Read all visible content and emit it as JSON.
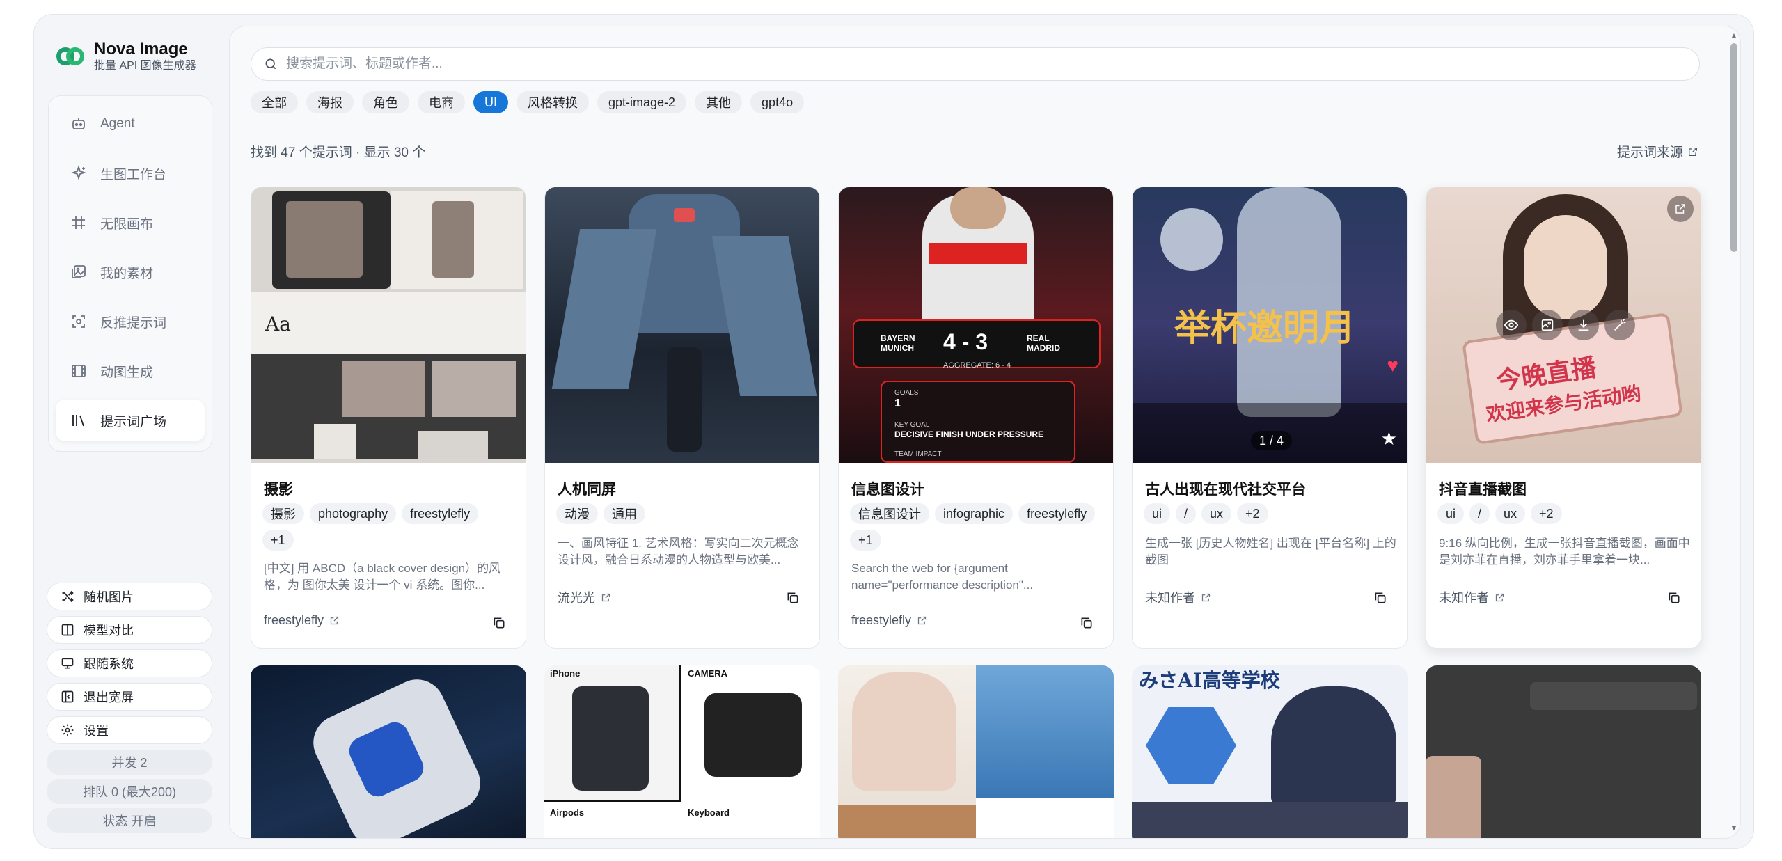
{
  "brand": {
    "name": "Nova Image",
    "subtitle": "批量 API 图像生成器"
  },
  "nav": [
    {
      "label": "Agent",
      "icon": "robot-icon"
    },
    {
      "label": "生图工作台",
      "icon": "sparkle-icon"
    },
    {
      "label": "无限画布",
      "icon": "hash-icon"
    },
    {
      "label": "我的素材",
      "icon": "images-icon"
    },
    {
      "label": "反推提示词",
      "icon": "scan-icon"
    },
    {
      "label": "动图生成",
      "icon": "film-icon"
    },
    {
      "label": "提示词广场",
      "icon": "library-icon",
      "active": true
    }
  ],
  "tools": [
    {
      "label": "随机图片",
      "icon": "shuffle-icon"
    },
    {
      "label": "模型对比",
      "icon": "columns-icon"
    },
    {
      "label": "跟随系统",
      "icon": "monitor-icon"
    },
    {
      "label": "退出宽屏",
      "icon": "exit-wide-icon"
    },
    {
      "label": "设置",
      "icon": "gear-icon"
    }
  ],
  "status": {
    "concurrency": "并发 2",
    "queue": "排队 0 (最大200)",
    "state": "状态 开启"
  },
  "search": {
    "placeholder": "搜索提示词、标题或作者..."
  },
  "filters": [
    "全部",
    "海报",
    "角色",
    "电商",
    "UI",
    "风格转换",
    "gpt-image-2",
    "其他",
    "gpt4o"
  ],
  "active_filter": "UI",
  "results": {
    "summary": "找到 47 个提示词 · 显示 30 个",
    "source_link": "提示词来源"
  },
  "cards": [
    {
      "title": "摄影",
      "tags": [
        "摄影",
        "photography",
        "freestylefly",
        "+1"
      ],
      "desc": "[中文] 用 ABCD（a black cover design）的风格，为 图你太美 设计一个 vi 系统。图你...",
      "author": "freestylefly"
    },
    {
      "title": "人机同屏",
      "tags": [
        "动漫",
        "通用"
      ],
      "desc": "一、画风特征 1. 艺术风格：写实向二次元概念设计风，融合日系动漫的人物造型与欧美...",
      "author": "流光光"
    },
    {
      "title": "信息图设计",
      "tags": [
        "信息图设计",
        "infographic",
        "freestylefly",
        "+1"
      ],
      "desc": "Search the web for {argument name=\"performance description\"...",
      "author": "freestylefly"
    },
    {
      "title": "古人出现在现代社交平台",
      "tags": [
        "ui",
        "/",
        "ux",
        "+2"
      ],
      "desc": "生成一张 [历史人物姓名] 出现在 [平台名称] 上的截图",
      "author": "未知作者"
    },
    {
      "title": "抖音直播截图",
      "tags": [
        "ui",
        "/",
        "ux",
        "+2"
      ],
      "desc": "9:16 纵向比例，生成一张抖音直播截图，画面中是刘亦菲在直播，刘亦菲手里拿着一块...",
      "author": "未知作者"
    }
  ],
  "image_text": {
    "match": {
      "team1": "BAYERN MUNICH",
      "score": "4 - 3",
      "team2": "REAL MADRID",
      "aggregate": "AGGREGATE: 6 - 4",
      "goals_label": "GOALS",
      "goals": "1",
      "key_goal_label": "KEY GOAL",
      "key_goal": "DECISIVE FINISH UNDER PRESSURE",
      "team_impact": "TEAM IMPACT"
    },
    "poem": "举杯邀明月",
    "pager": "1 / 4",
    "live_sign": [
      "今晚直播",
      "欢迎来参与活动哟"
    ],
    "iphone": "iPhone",
    "camera": "CAMERA",
    "airpods": "Airpods",
    "keyboard": "Keyboard",
    "school": "みさAI高等学校"
  },
  "colors": {
    "accent": "#1677d8",
    "background": "#f3f5f8"
  }
}
